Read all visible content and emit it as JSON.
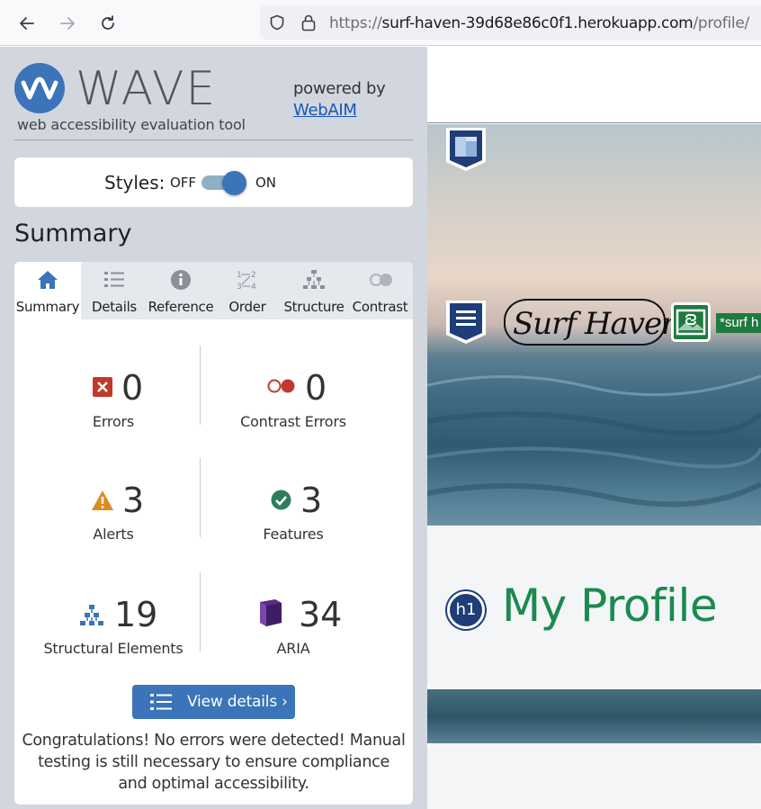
{
  "browser": {
    "url_prefix": "https://",
    "url_host": "surf-haven-39d68e86c0f1.herokuapp.com",
    "url_path": "/profile/"
  },
  "wave": {
    "title": "WAVE",
    "tagline": "web accessibility evaluation tool",
    "powered_by": "powered by",
    "webaim_link": "WebAIM",
    "styles_label": "Styles:",
    "toggle_off": "OFF",
    "toggle_on": "ON",
    "styles_on": true,
    "summary_heading": "Summary",
    "tabs": [
      {
        "label": "Summary",
        "icon": "home-icon",
        "active": true
      },
      {
        "label": "Details",
        "icon": "list-icon",
        "active": false
      },
      {
        "label": "Reference",
        "icon": "info-icon",
        "active": false
      },
      {
        "label": "Order",
        "icon": "order-icon",
        "active": false
      },
      {
        "label": "Structure",
        "icon": "structure-icon",
        "active": false
      },
      {
        "label": "Contrast",
        "icon": "contrast-icon",
        "active": false
      }
    ],
    "stats": {
      "errors": {
        "value": "0",
        "label": "Errors"
      },
      "contrast_errors": {
        "value": "0",
        "label": "Contrast Errors"
      },
      "alerts": {
        "value": "3",
        "label": "Alerts"
      },
      "features": {
        "value": "3",
        "label": "Features"
      },
      "structural": {
        "value": "19",
        "label": "Structural Elements"
      },
      "aria": {
        "value": "34",
        "label": "ARIA"
      }
    },
    "view_details": "View details ›",
    "congrats": "Congratulations! No errors were detected! Manual testing is still necessary to ensure compliance and optimal accessibility.",
    "colors": {
      "accent": "#3b74b8",
      "error": "#c0392b",
      "alert": "#e08a1e",
      "feature": "#2e7d5b",
      "aria": "#5b2c8a"
    }
  },
  "preview": {
    "logo_text": "Surf Haven",
    "alt_text": "*surf h",
    "heading_badge": "h1",
    "heading": "My Profile"
  }
}
